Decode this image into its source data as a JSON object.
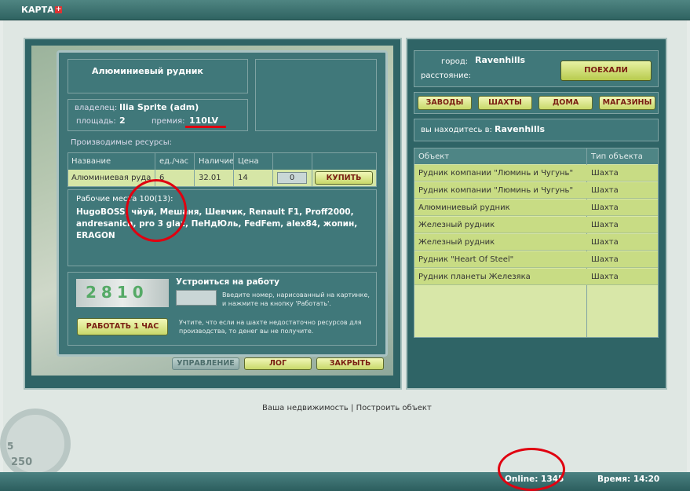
{
  "header": {
    "title": "КАРТА",
    "plus": "+"
  },
  "building": {
    "name": "Алюминиевый рудник",
    "owner_label": "владелец:",
    "owner": "Ilia Sprite (adm)",
    "area_label": "площадь:",
    "area": "2",
    "bonus_label": "премия:",
    "bonus": "110LV"
  },
  "resources": {
    "title": "Производимые ресурсы:",
    "columns": [
      "Название",
      "ед./час",
      "Наличие",
      "Цена"
    ],
    "row": {
      "name": "Алюминиевая руда",
      "per_hour": "6",
      "stock": "32.01",
      "price": "14",
      "qty": "0"
    },
    "buy_label": "КУПИТЬ"
  },
  "workers": {
    "label": "Рабочие места 100(13):",
    "names": "HugoBOSS, чйуй, Мешаня, Шевчик, Renault F1, Proff2000, andresanich, pro 3 glaz, ПеНдЮль, FedFem, alex84, жопин, ERAGON"
  },
  "job": {
    "title": "Устроиться на работу",
    "captcha": "2810",
    "hint": "Введите номер, нарисованный на картинке, и нажмите на кнопку 'Работать'.",
    "work_label": "РАБОТАТЬ 1 ЧАС",
    "warning": "Учтите, что если на шахте недостаточно ресурсов для производства, то денег вы не получите."
  },
  "bottom_buttons": {
    "manage": "УПРАВЛЕНИЕ",
    "log": "ЛОГ",
    "close": "ЗАКРЫТЬ"
  },
  "travel": {
    "city_label": "город:",
    "city": "Ravenhills",
    "distance_label": "расстояние:",
    "go_label": "ПОЕХАЛИ"
  },
  "tabs": [
    "ЗАВОДЫ",
    "ШАХТЫ",
    "ДОМА",
    "МАГАЗИНЫ"
  ],
  "location": {
    "label": "вы находитесь в:",
    "city": "Ravenhills"
  },
  "objects": {
    "columns": [
      "Объект",
      "Тип объекта"
    ],
    "rows": [
      {
        "name": "Рудник компании \"Люминь и Чугунь\"",
        "type": "Шахта"
      },
      {
        "name": "Рудник компании \"Люминь и Чугунь\"",
        "type": "Шахта"
      },
      {
        "name": "Алюминиевый рудник",
        "type": "Шахта"
      },
      {
        "name": "Железный рудник",
        "type": "Шахта"
      },
      {
        "name": "Железный рудник",
        "type": "Шахта"
      },
      {
        "name": "Рудник \"Heart Of Steel\"",
        "type": "Шахта"
      },
      {
        "name": "Рудник планеты Железяка",
        "type": "Шахта"
      }
    ]
  },
  "links": {
    "realty": "Ваша недвижимость",
    "separator": "|",
    "build": "Построить объект"
  },
  "speedo": {
    "a": "5",
    "b": "250"
  },
  "status": {
    "online": "Online: 1345",
    "time": "Время: 14:20"
  }
}
